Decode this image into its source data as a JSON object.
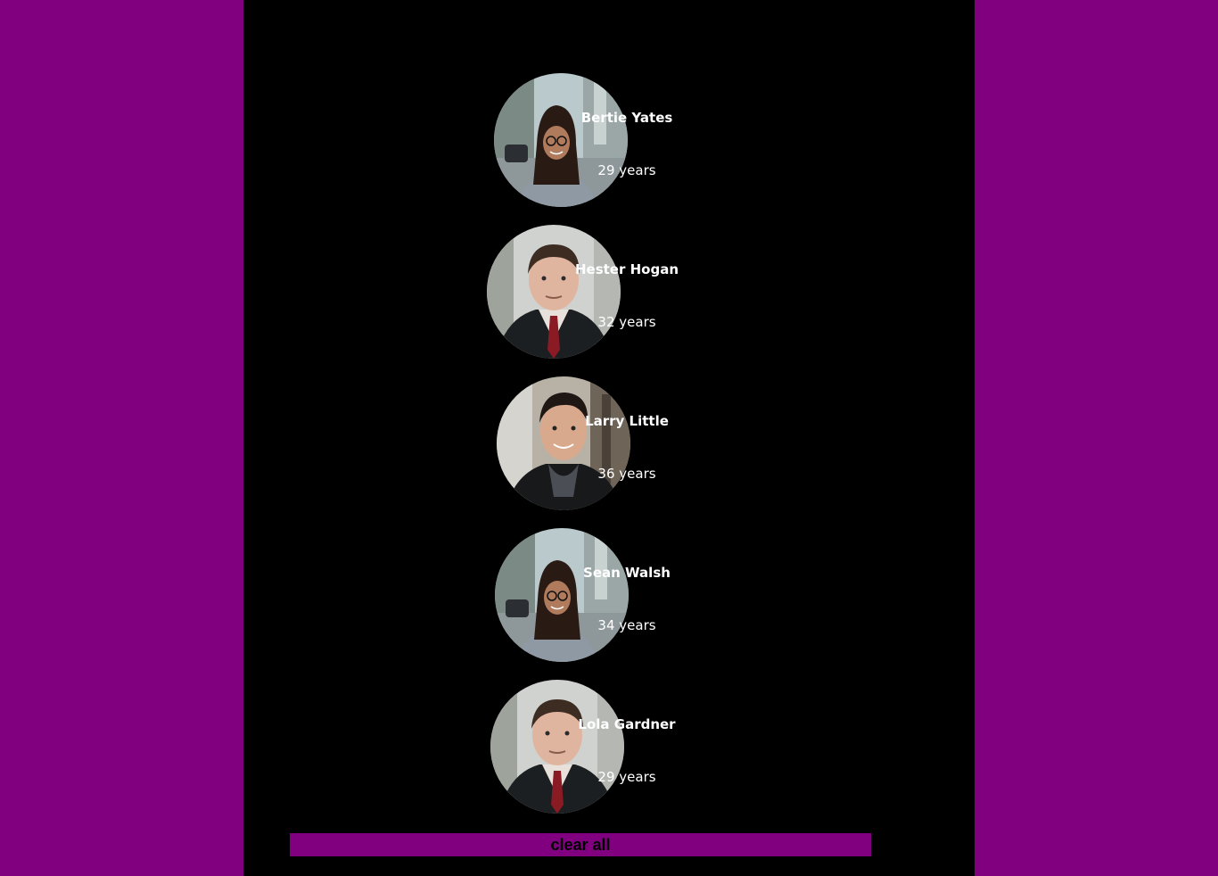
{
  "people": [
    {
      "name": "Bertie Yates",
      "age": "29 years",
      "photo": "woman-glasses-street-photo"
    },
    {
      "name": "Hester Hogan",
      "age": "32 years",
      "photo": "man-suit-red-tie-photo"
    },
    {
      "name": "Larry Little",
      "age": "36 years",
      "photo": "man-dark-jacket-scarf-photo"
    },
    {
      "name": "Sean Walsh",
      "age": "34 years",
      "photo": "woman-glasses-street-photo"
    },
    {
      "name": "Lola Gardner",
      "age": "29 years",
      "photo": "man-suit-red-tie-photo"
    }
  ],
  "clear_button_label": "clear all",
  "colors": {
    "page_background": "#800080",
    "panel_background": "#000000",
    "button_background": "#800080",
    "text": "#ffffff"
  }
}
